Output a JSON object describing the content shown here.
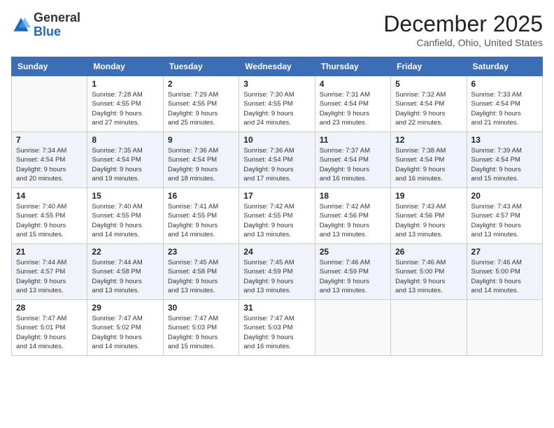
{
  "header": {
    "logo_general": "General",
    "logo_blue": "Blue",
    "month": "December 2025",
    "location": "Canfield, Ohio, United States"
  },
  "weekdays": [
    "Sunday",
    "Monday",
    "Tuesday",
    "Wednesday",
    "Thursday",
    "Friday",
    "Saturday"
  ],
  "weeks": [
    [
      {
        "day": "",
        "info": ""
      },
      {
        "day": "1",
        "info": "Sunrise: 7:28 AM\nSunset: 4:55 PM\nDaylight: 9 hours\nand 27 minutes."
      },
      {
        "day": "2",
        "info": "Sunrise: 7:29 AM\nSunset: 4:55 PM\nDaylight: 9 hours\nand 25 minutes."
      },
      {
        "day": "3",
        "info": "Sunrise: 7:30 AM\nSunset: 4:55 PM\nDaylight: 9 hours\nand 24 minutes."
      },
      {
        "day": "4",
        "info": "Sunrise: 7:31 AM\nSunset: 4:54 PM\nDaylight: 9 hours\nand 23 minutes."
      },
      {
        "day": "5",
        "info": "Sunrise: 7:32 AM\nSunset: 4:54 PM\nDaylight: 9 hours\nand 22 minutes."
      },
      {
        "day": "6",
        "info": "Sunrise: 7:33 AM\nSunset: 4:54 PM\nDaylight: 9 hours\nand 21 minutes."
      }
    ],
    [
      {
        "day": "7",
        "info": "Sunrise: 7:34 AM\nSunset: 4:54 PM\nDaylight: 9 hours\nand 20 minutes."
      },
      {
        "day": "8",
        "info": "Sunrise: 7:35 AM\nSunset: 4:54 PM\nDaylight: 9 hours\nand 19 minutes."
      },
      {
        "day": "9",
        "info": "Sunrise: 7:36 AM\nSunset: 4:54 PM\nDaylight: 9 hours\nand 18 minutes."
      },
      {
        "day": "10",
        "info": "Sunrise: 7:36 AM\nSunset: 4:54 PM\nDaylight: 9 hours\nand 17 minutes."
      },
      {
        "day": "11",
        "info": "Sunrise: 7:37 AM\nSunset: 4:54 PM\nDaylight: 9 hours\nand 16 minutes."
      },
      {
        "day": "12",
        "info": "Sunrise: 7:38 AM\nSunset: 4:54 PM\nDaylight: 9 hours\nand 16 minutes."
      },
      {
        "day": "13",
        "info": "Sunrise: 7:39 AM\nSunset: 4:54 PM\nDaylight: 9 hours\nand 15 minutes."
      }
    ],
    [
      {
        "day": "14",
        "info": "Sunrise: 7:40 AM\nSunset: 4:55 PM\nDaylight: 9 hours\nand 15 minutes."
      },
      {
        "day": "15",
        "info": "Sunrise: 7:40 AM\nSunset: 4:55 PM\nDaylight: 9 hours\nand 14 minutes."
      },
      {
        "day": "16",
        "info": "Sunrise: 7:41 AM\nSunset: 4:55 PM\nDaylight: 9 hours\nand 14 minutes."
      },
      {
        "day": "17",
        "info": "Sunrise: 7:42 AM\nSunset: 4:55 PM\nDaylight: 9 hours\nand 13 minutes."
      },
      {
        "day": "18",
        "info": "Sunrise: 7:42 AM\nSunset: 4:56 PM\nDaylight: 9 hours\nand 13 minutes."
      },
      {
        "day": "19",
        "info": "Sunrise: 7:43 AM\nSunset: 4:56 PM\nDaylight: 9 hours\nand 13 minutes."
      },
      {
        "day": "20",
        "info": "Sunrise: 7:43 AM\nSunset: 4:57 PM\nDaylight: 9 hours\nand 13 minutes."
      }
    ],
    [
      {
        "day": "21",
        "info": "Sunrise: 7:44 AM\nSunset: 4:57 PM\nDaylight: 9 hours\nand 13 minutes."
      },
      {
        "day": "22",
        "info": "Sunrise: 7:44 AM\nSunset: 4:58 PM\nDaylight: 9 hours\nand 13 minutes."
      },
      {
        "day": "23",
        "info": "Sunrise: 7:45 AM\nSunset: 4:58 PM\nDaylight: 9 hours\nand 13 minutes."
      },
      {
        "day": "24",
        "info": "Sunrise: 7:45 AM\nSunset: 4:59 PM\nDaylight: 9 hours\nand 13 minutes."
      },
      {
        "day": "25",
        "info": "Sunrise: 7:46 AM\nSunset: 4:59 PM\nDaylight: 9 hours\nand 13 minutes."
      },
      {
        "day": "26",
        "info": "Sunrise: 7:46 AM\nSunset: 5:00 PM\nDaylight: 9 hours\nand 13 minutes."
      },
      {
        "day": "27",
        "info": "Sunrise: 7:46 AM\nSunset: 5:00 PM\nDaylight: 9 hours\nand 14 minutes."
      }
    ],
    [
      {
        "day": "28",
        "info": "Sunrise: 7:47 AM\nSunset: 5:01 PM\nDaylight: 9 hours\nand 14 minutes."
      },
      {
        "day": "29",
        "info": "Sunrise: 7:47 AM\nSunset: 5:02 PM\nDaylight: 9 hours\nand 14 minutes."
      },
      {
        "day": "30",
        "info": "Sunrise: 7:47 AM\nSunset: 5:03 PM\nDaylight: 9 hours\nand 15 minutes."
      },
      {
        "day": "31",
        "info": "Sunrise: 7:47 AM\nSunset: 5:03 PM\nDaylight: 9 hours\nand 16 minutes."
      },
      {
        "day": "",
        "info": ""
      },
      {
        "day": "",
        "info": ""
      },
      {
        "day": "",
        "info": ""
      }
    ]
  ]
}
